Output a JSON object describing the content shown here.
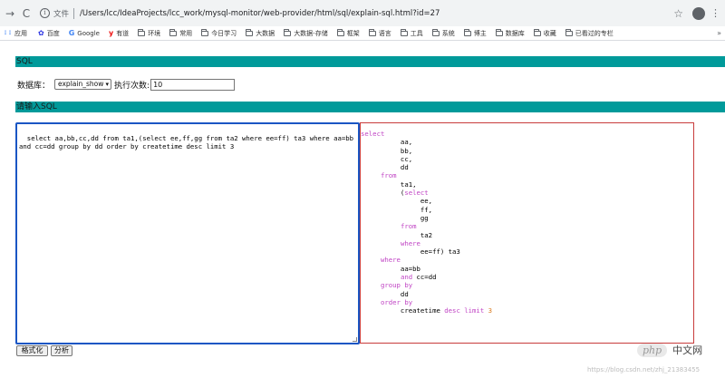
{
  "browser": {
    "scheme_label": "文件",
    "url": "/Users/lcc/IdeaProjects/lcc_work/mysql-monitor/web-provider/html/sql/explain-sql.html?id=27",
    "profile_initial": "●",
    "bookmarks": [
      {
        "label": "应用",
        "icon": "apps-icon"
      },
      {
        "label": "百度",
        "icon": "baidu-icon"
      },
      {
        "label": "Google",
        "icon": "google-icon"
      },
      {
        "label": "有道",
        "icon": "youdao-icon"
      },
      {
        "label": "环境",
        "icon": "folder-icon"
      },
      {
        "label": "常用",
        "icon": "folder-icon"
      },
      {
        "label": "今日学习",
        "icon": "folder-icon"
      },
      {
        "label": "大数据",
        "icon": "folder-icon"
      },
      {
        "label": "大数据-存储",
        "icon": "folder-icon"
      },
      {
        "label": "框架",
        "icon": "folder-icon"
      },
      {
        "label": "语言",
        "icon": "folder-icon"
      },
      {
        "label": "工具",
        "icon": "folder-icon"
      },
      {
        "label": "系统",
        "icon": "folder-icon"
      },
      {
        "label": "博主",
        "icon": "folder-icon"
      },
      {
        "label": "数据库",
        "icon": "folder-icon"
      },
      {
        "label": "收藏",
        "icon": "folder-icon"
      },
      {
        "label": "已看过的专栏",
        "icon": "folder-icon"
      }
    ],
    "more_label": "»"
  },
  "page": {
    "section_sql": "SQL",
    "db_label": "数据库：",
    "db_selected": "explain_show",
    "count_label": "执行次数:",
    "count_value": "10",
    "section_input": "请输入SQL",
    "sql_input": "select aa,bb,cc,dd from ta1,(select ee,ff,gg from ta2 where ee=ff) ta3 where aa=bb and cc=dd group by dd order by createtime desc limit 3",
    "format_button": "格式化",
    "analyze_button": "分析"
  },
  "formatted_sql": [
    [
      {
        "t": "select",
        "k": "kw"
      }
    ],
    [
      {
        "t": "          aa,"
      }
    ],
    [
      {
        "t": "          bb,"
      }
    ],
    [
      {
        "t": "          cc,"
      }
    ],
    [
      {
        "t": "          dd"
      }
    ],
    [
      {
        "t": "     "
      },
      {
        "t": "from",
        "k": "kw"
      }
    ],
    [
      {
        "t": "          ta1,"
      }
    ],
    [
      {
        "t": "          ("
      },
      {
        "t": "select",
        "k": "kw"
      }
    ],
    [
      {
        "t": "               ee,"
      }
    ],
    [
      {
        "t": "               ff,"
      }
    ],
    [
      {
        "t": "               gg"
      }
    ],
    [
      {
        "t": "          "
      },
      {
        "t": "from",
        "k": "kw"
      }
    ],
    [
      {
        "t": "               ta2"
      }
    ],
    [
      {
        "t": "          "
      },
      {
        "t": "where",
        "k": "kw"
      }
    ],
    [
      {
        "t": "               ee=ff) ta3"
      }
    ],
    [
      {
        "t": "     "
      },
      {
        "t": "where",
        "k": "kw"
      }
    ],
    [
      {
        "t": "          aa=bb"
      }
    ],
    [
      {
        "t": "          "
      },
      {
        "t": "and",
        "k": "kw"
      },
      {
        "t": " cc=dd"
      }
    ],
    [
      {
        "t": "     "
      },
      {
        "t": "group by",
        "k": "kw"
      }
    ],
    [
      {
        "t": "          dd"
      }
    ],
    [
      {
        "t": "     "
      },
      {
        "t": "order by",
        "k": "kw"
      }
    ],
    [
      {
        "t": "          createtime "
      },
      {
        "t": "desc",
        "k": "kw"
      },
      {
        "t": " "
      },
      {
        "t": "limit",
        "k": "kw"
      },
      {
        "t": " "
      },
      {
        "t": "3",
        "k": "num"
      }
    ]
  ],
  "watermark": {
    "logo": "php",
    "text": "中文网",
    "url": "https://blog.csdn.net/zhj_21383455"
  }
}
